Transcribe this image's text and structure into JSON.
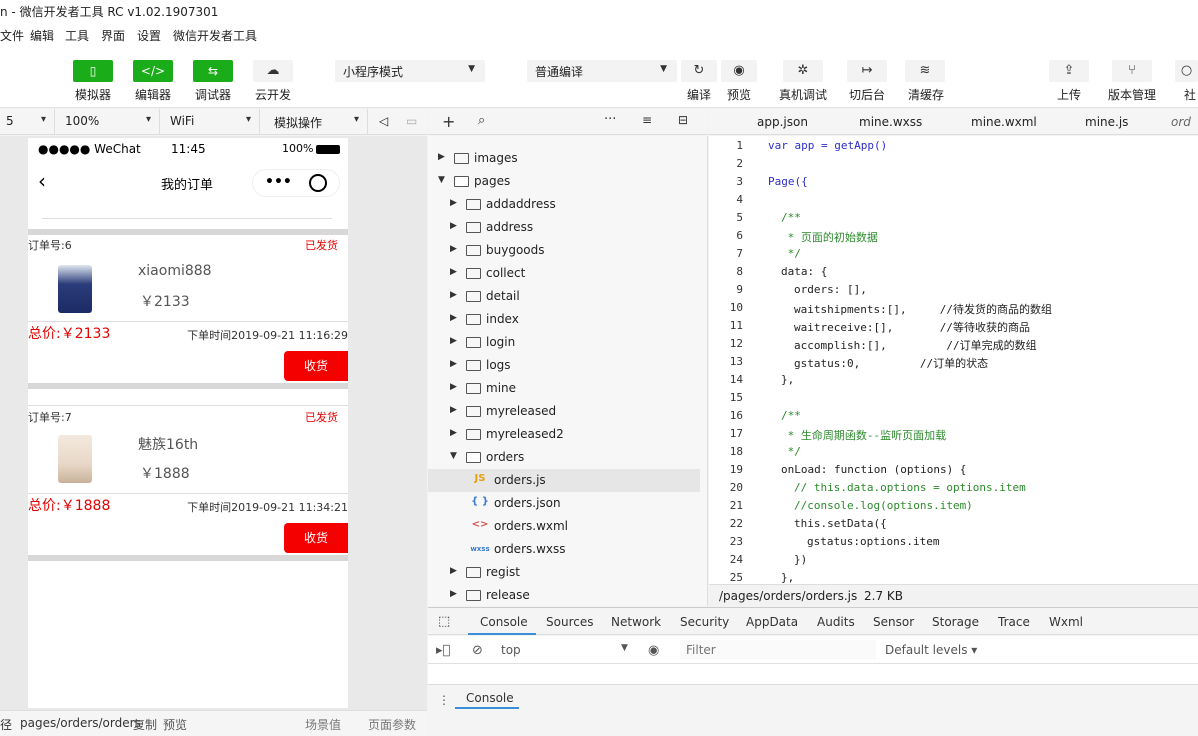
{
  "window": {
    "title": "n - 微信开发者工具 RC v1.02.1907301"
  },
  "menu": [
    "文件",
    "编辑",
    "工具",
    "界面",
    "设置",
    "微信开发者工具"
  ],
  "toolbar": {
    "simulator": "模拟器",
    "editor": "编辑器",
    "debugger": "调试器",
    "cloud": "云开发",
    "mode_select": "小程序模式",
    "compile_select": "普通编译",
    "compile": "编译",
    "preview": "预览",
    "remote_debug": "真机调试",
    "background": "切后台",
    "clear_cache": "清缓存",
    "upload": "上传",
    "version": "版本管理",
    "community": "社"
  },
  "simbar": {
    "device": "5",
    "zoom": "100%",
    "network": "WiFi",
    "action": "模拟操作"
  },
  "phone": {
    "carrier": "●●●●● WeChat",
    "time": "11:45",
    "battery": "100%",
    "nav_title": "我的订单",
    "orders": [
      {
        "id": "订单号:6",
        "status": "已发货",
        "name": "xiaomi888",
        "price": "￥2133",
        "total": "总价:￥2133",
        "time": "下单时间2019-09-21 11:16:29",
        "button": "收货"
      },
      {
        "id": "订单号:7",
        "status": "已发货",
        "name": "魅族16th",
        "price": "￥1888",
        "total": "总价:￥1888",
        "time": "下单时间2019-09-21 11:34:21",
        "button": "收货"
      }
    ]
  },
  "sim_footer": {
    "path_label": "径",
    "path": "pages/orders/orders",
    "copy": "复制",
    "preview": "预览",
    "scene": "场景值",
    "params": "页面参数"
  },
  "filetree": [
    {
      "name": "images",
      "kind": "folder",
      "level": 0,
      "open": false
    },
    {
      "name": "pages",
      "kind": "folder",
      "level": 0,
      "open": true
    },
    {
      "name": "addaddress",
      "kind": "folder",
      "level": 1,
      "open": false
    },
    {
      "name": "address",
      "kind": "folder",
      "level": 1,
      "open": false
    },
    {
      "name": "buygoods",
      "kind": "folder",
      "level": 1,
      "open": false
    },
    {
      "name": "collect",
      "kind": "folder",
      "level": 1,
      "open": false
    },
    {
      "name": "detail",
      "kind": "folder",
      "level": 1,
      "open": false
    },
    {
      "name": "index",
      "kind": "folder",
      "level": 1,
      "open": false
    },
    {
      "name": "login",
      "kind": "folder",
      "level": 1,
      "open": false
    },
    {
      "name": "logs",
      "kind": "folder",
      "level": 1,
      "open": false
    },
    {
      "name": "mine",
      "kind": "folder",
      "level": 1,
      "open": false
    },
    {
      "name": "myreleased",
      "kind": "folder",
      "level": 1,
      "open": false
    },
    {
      "name": "myreleased2",
      "kind": "folder",
      "level": 1,
      "open": false
    },
    {
      "name": "orders",
      "kind": "folder",
      "level": 1,
      "open": true
    },
    {
      "name": "orders.js",
      "kind": "js",
      "level": 2,
      "selected": true
    },
    {
      "name": "orders.json",
      "kind": "json",
      "level": 2
    },
    {
      "name": "orders.wxml",
      "kind": "wxml",
      "level": 2
    },
    {
      "name": "orders.wxss",
      "kind": "wxss",
      "level": 2
    },
    {
      "name": "regist",
      "kind": "folder",
      "level": 1,
      "open": false
    },
    {
      "name": "release",
      "kind": "folder",
      "level": 1,
      "open": false
    }
  ],
  "file_icons": {
    "js": "JS",
    "json": "{ }",
    "wxml": "<>",
    "wxss": "wxss"
  },
  "tabs": [
    "app.json",
    "mine.wxss",
    "mine.wxml",
    "mine.js",
    "ord"
  ],
  "code": [
    {
      "n": "1",
      "t": "var app = getApp()",
      "c": "kw",
      "indent": 0
    },
    {
      "n": "2",
      "t": "",
      "indent": 0
    },
    {
      "n": "3",
      "t": "Page({",
      "c": "kw",
      "indent": 0
    },
    {
      "n": "4",
      "t": "",
      "indent": 0
    },
    {
      "n": "5",
      "t": "/**",
      "c": "cm",
      "indent": 1
    },
    {
      "n": "6",
      "t": " * 页面的初始数据",
      "c": "cm",
      "indent": 1
    },
    {
      "n": "7",
      "t": " */",
      "c": "cm",
      "indent": 1
    },
    {
      "n": "8",
      "t": "data: {",
      "indent": 1
    },
    {
      "n": "9",
      "t": "orders: [],",
      "indent": 2
    },
    {
      "n": "10",
      "t": "waitshipments:[],     //待发货的商品的数组",
      "indent": 2
    },
    {
      "n": "11",
      "t": "waitreceive:[],       //等待收获的商品",
      "indent": 2
    },
    {
      "n": "12",
      "t": "accomplish:[],         //订单完成的数组",
      "indent": 2
    },
    {
      "n": "13",
      "t": "gstatus:0,         //订单的状态",
      "indent": 2
    },
    {
      "n": "14",
      "t": "},",
      "indent": 1
    },
    {
      "n": "15",
      "t": "",
      "indent": 0
    },
    {
      "n": "16",
      "t": "/**",
      "c": "cm",
      "indent": 1
    },
    {
      "n": "17",
      "t": " * 生命周期函数--监听页面加载",
      "c": "cm",
      "indent": 1
    },
    {
      "n": "18",
      "t": " */",
      "c": "cm",
      "indent": 1
    },
    {
      "n": "19",
      "t": "onLoad: function (options) {",
      "indent": 1
    },
    {
      "n": "20",
      "t": "// this.data.options = options.item",
      "c": "cm",
      "indent": 2
    },
    {
      "n": "21",
      "t": "//console.log(options.item)",
      "c": "cm",
      "indent": 2
    },
    {
      "n": "22",
      "t": "this.setData({",
      "indent": 2
    },
    {
      "n": "23",
      "t": "gstatus:options.item",
      "indent": 3
    },
    {
      "n": "24",
      "t": "})",
      "indent": 2
    },
    {
      "n": "25",
      "t": "},",
      "indent": 1
    }
  ],
  "status": {
    "path": "/pages/orders/orders.js",
    "size": "2.7 KB"
  },
  "devtools": {
    "tabs": [
      "Console",
      "Sources",
      "Network",
      "Security",
      "AppData",
      "Audits",
      "Sensor",
      "Storage",
      "Trace",
      "Wxml"
    ],
    "context": "top",
    "filter_placeholder": "Filter",
    "levels": "Default levels ▾",
    "drawer_tab": "Console"
  },
  "colors": {
    "green": "#1aad19",
    "red": "#e30000",
    "accent": "#3a8fd8"
  }
}
